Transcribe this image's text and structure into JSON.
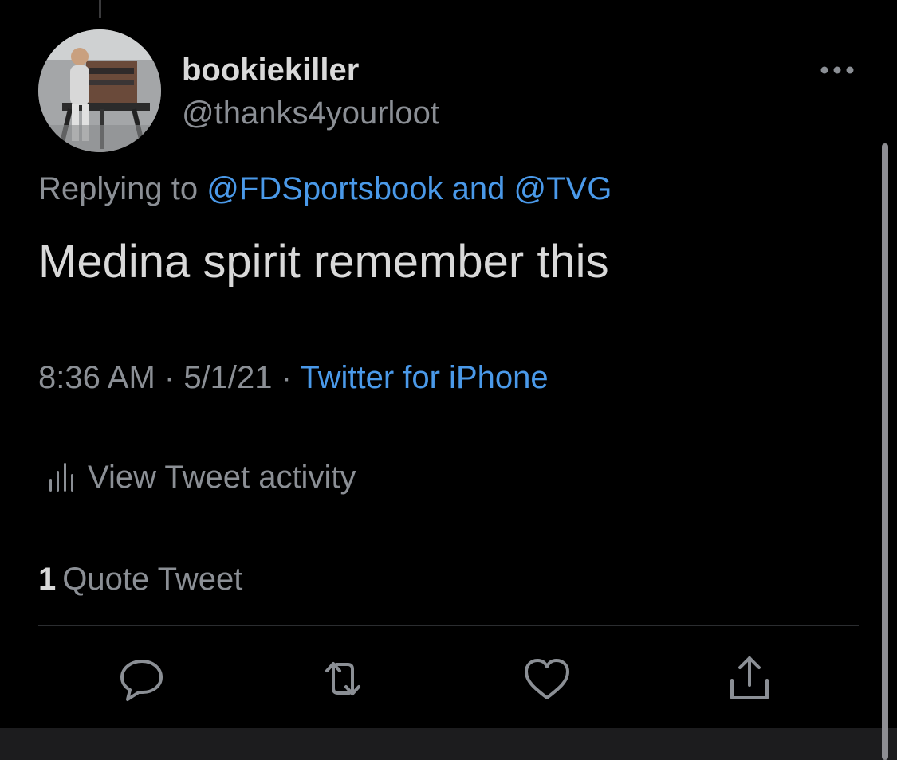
{
  "tweet": {
    "author": {
      "display_name": "bookiekiller",
      "handle": "@thanks4yourloot"
    },
    "reply": {
      "prefix": "Replying to ",
      "mention_1": "@FDSportsbook",
      "joiner": " and ",
      "mention_2": "@TVG"
    },
    "text": "Medina spirit remember this",
    "meta": {
      "time": "8:36 AM",
      "sep_1": " · ",
      "date": "5/1/21",
      "sep_2": " · ",
      "source": "Twitter for iPhone"
    },
    "activity_label": "View Tweet activity",
    "quotes": {
      "count": "1",
      "label": "Quote Tweet"
    }
  },
  "actions": [
    "reply-icon",
    "retweet-icon",
    "like-icon",
    "share-icon"
  ],
  "colors": {
    "background": "#000000",
    "primary_text": "#d9d9d9",
    "secondary_text": "#8b8f95",
    "link": "#4a99e9",
    "divider": "#2b2d30"
  }
}
